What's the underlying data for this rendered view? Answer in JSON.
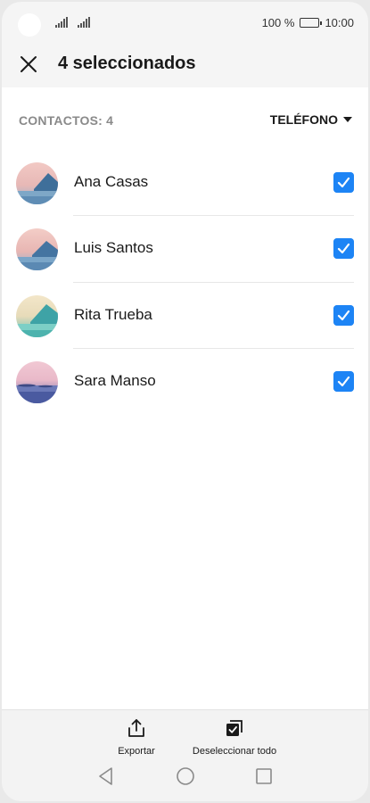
{
  "status_bar": {
    "battery_text": "100 %",
    "time": "10:00"
  },
  "header": {
    "title": "4 seleccionados",
    "close_icon": "close-icon"
  },
  "list": {
    "count_label": "CONTACTOS: 4",
    "sort_label": "TELÉFONO",
    "contacts": [
      {
        "name": "Ana Casas",
        "checked": true
      },
      {
        "name": "Luis Santos",
        "checked": true
      },
      {
        "name": "Rita Trueba",
        "checked": true
      },
      {
        "name": "Sara Manso",
        "checked": true
      }
    ]
  },
  "bottom_bar": {
    "export_label": "Exportar",
    "deselect_label": "Deseleccionar todo"
  },
  "colors": {
    "accent": "#1d84f5",
    "background": "#f5f5f5"
  }
}
